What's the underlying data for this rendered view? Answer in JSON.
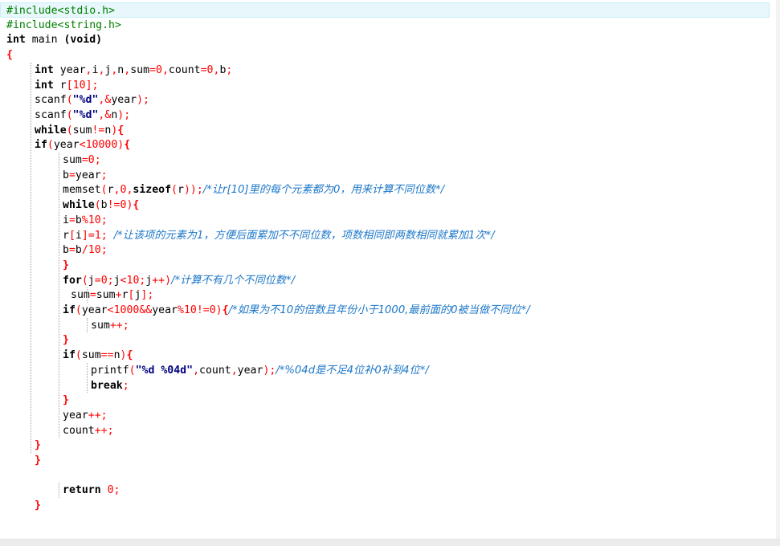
{
  "editor": {
    "language": "C",
    "lines": [
      {
        "indent": 0,
        "tokens": [
          [
            "pp",
            "#include<stdio.h>"
          ]
        ]
      },
      {
        "indent": 0,
        "tokens": [
          [
            "pp",
            "#include<string.h>"
          ]
        ]
      },
      {
        "indent": 0,
        "tokens": [
          [
            "kw",
            "int"
          ],
          [
            "id",
            " main "
          ],
          [
            "kw",
            "(void)"
          ]
        ]
      },
      {
        "indent": 0,
        "tokens": [
          [
            "brace",
            "{"
          ]
        ]
      },
      {
        "indent": 1,
        "tokens": [
          [
            "kw",
            "int"
          ],
          [
            "id",
            " year"
          ],
          [
            "op",
            ","
          ],
          [
            "id",
            "i"
          ],
          [
            "op",
            ","
          ],
          [
            "id",
            "j"
          ],
          [
            "op",
            ","
          ],
          [
            "id",
            "n"
          ],
          [
            "op",
            ","
          ],
          [
            "id",
            "sum"
          ],
          [
            "op",
            "="
          ],
          [
            "num",
            "0"
          ],
          [
            "op",
            ","
          ],
          [
            "id",
            "count"
          ],
          [
            "op",
            "="
          ],
          [
            "num",
            "0"
          ],
          [
            "op",
            ","
          ],
          [
            "id",
            "b"
          ],
          [
            "op",
            ";"
          ]
        ]
      },
      {
        "indent": 1,
        "tokens": [
          [
            "kw",
            "int"
          ],
          [
            "id",
            " r"
          ],
          [
            "op",
            "["
          ],
          [
            "num",
            "10"
          ],
          [
            "op",
            "]"
          ],
          [
            "op",
            ";"
          ]
        ]
      },
      {
        "indent": 1,
        "tokens": [
          [
            "id",
            "scanf"
          ],
          [
            "op",
            "("
          ],
          [
            "str",
            "\"%d\""
          ],
          [
            "op",
            ","
          ],
          [
            "op",
            "&"
          ],
          [
            "id",
            "year"
          ],
          [
            "op",
            ")"
          ],
          [
            "op",
            ";"
          ]
        ]
      },
      {
        "indent": 1,
        "tokens": [
          [
            "id",
            "scanf"
          ],
          [
            "op",
            "("
          ],
          [
            "str",
            "\"%d\""
          ],
          [
            "op",
            ","
          ],
          [
            "op",
            "&"
          ],
          [
            "id",
            "n"
          ],
          [
            "op",
            ")"
          ],
          [
            "op",
            ";"
          ]
        ]
      },
      {
        "indent": 1,
        "tokens": [
          [
            "kw",
            "while"
          ],
          [
            "op",
            "("
          ],
          [
            "id",
            "sum"
          ],
          [
            "op",
            "!="
          ],
          [
            "id",
            "n"
          ],
          [
            "op",
            ")"
          ],
          [
            "brace",
            "{"
          ]
        ]
      },
      {
        "indent": 1,
        "tokens": [
          [
            "kw",
            "if"
          ],
          [
            "op",
            "("
          ],
          [
            "id",
            "year"
          ],
          [
            "op",
            "<"
          ],
          [
            "num",
            "10000"
          ],
          [
            "op",
            ")"
          ],
          [
            "brace",
            "{"
          ]
        ]
      },
      {
        "indent": 2,
        "tokens": [
          [
            "id",
            "sum"
          ],
          [
            "op",
            "="
          ],
          [
            "num",
            "0"
          ],
          [
            "op",
            ";"
          ]
        ]
      },
      {
        "indent": 2,
        "tokens": [
          [
            "id",
            "b"
          ],
          [
            "op",
            "="
          ],
          [
            "id",
            "year"
          ],
          [
            "op",
            ";"
          ]
        ]
      },
      {
        "indent": 2,
        "tokens": [
          [
            "id",
            "memset"
          ],
          [
            "op",
            "("
          ],
          [
            "id",
            "r"
          ],
          [
            "op",
            ","
          ],
          [
            "num",
            "0"
          ],
          [
            "op",
            ","
          ],
          [
            "kw",
            "sizeof"
          ],
          [
            "op",
            "("
          ],
          [
            "id",
            "r"
          ],
          [
            "op",
            "))"
          ],
          [
            "op",
            ";"
          ],
          [
            "cmt",
            "/*让r[10]里的每个元素都为0，用来计算不同位数*/"
          ]
        ]
      },
      {
        "indent": 2,
        "tokens": [
          [
            "kw",
            "while"
          ],
          [
            "op",
            "("
          ],
          [
            "id",
            "b"
          ],
          [
            "op",
            "!="
          ],
          [
            "num",
            "0"
          ],
          [
            "op",
            ")"
          ],
          [
            "brace",
            "{"
          ]
        ]
      },
      {
        "indent": 2,
        "tokens": [
          [
            "id",
            "i"
          ],
          [
            "op",
            "="
          ],
          [
            "id",
            "b"
          ],
          [
            "op",
            "%"
          ],
          [
            "num",
            "10"
          ],
          [
            "op",
            ";"
          ]
        ]
      },
      {
        "indent": 2,
        "tokens": [
          [
            "id",
            "r"
          ],
          [
            "op",
            "["
          ],
          [
            "id",
            "i"
          ],
          [
            "op",
            "]="
          ],
          [
            "num",
            "1"
          ],
          [
            "op",
            ";"
          ],
          [
            "id",
            " "
          ],
          [
            "cmt",
            "/*让该项的元素为1，方便后面累加不不同位数，项数相同即两数相同就累加1次*/"
          ]
        ]
      },
      {
        "indent": 2,
        "tokens": [
          [
            "id",
            "b"
          ],
          [
            "op",
            "="
          ],
          [
            "id",
            "b"
          ],
          [
            "op",
            "/"
          ],
          [
            "num",
            "10"
          ],
          [
            "op",
            ";"
          ]
        ]
      },
      {
        "indent": 2,
        "tokens": [
          [
            "brace",
            "}"
          ]
        ]
      },
      {
        "indent": 2,
        "tokens": [
          [
            "kw",
            "for"
          ],
          [
            "op",
            "("
          ],
          [
            "id",
            "j"
          ],
          [
            "op",
            "="
          ],
          [
            "num",
            "0"
          ],
          [
            "op",
            ";"
          ],
          [
            "id",
            "j"
          ],
          [
            "op",
            "<"
          ],
          [
            "num",
            "10"
          ],
          [
            "op",
            ";"
          ],
          [
            "id",
            "j"
          ],
          [
            "op",
            "++)"
          ],
          [
            "cmt",
            "/*计算不有几个不同位数*/"
          ]
        ]
      },
      {
        "indent": 2,
        "extra": 1,
        "tokens": [
          [
            "id",
            "sum"
          ],
          [
            "op",
            "="
          ],
          [
            "id",
            "sum"
          ],
          [
            "op",
            "+"
          ],
          [
            "id",
            "r"
          ],
          [
            "op",
            "["
          ],
          [
            "id",
            "j"
          ],
          [
            "op",
            "]"
          ],
          [
            "op",
            ";"
          ]
        ]
      },
      {
        "indent": 2,
        "tokens": [
          [
            "kw",
            "if"
          ],
          [
            "op",
            "("
          ],
          [
            "id",
            "year"
          ],
          [
            "op",
            "<"
          ],
          [
            "num",
            "1000"
          ],
          [
            "op",
            "&&"
          ],
          [
            "id",
            "year"
          ],
          [
            "op",
            "%"
          ],
          [
            "num",
            "10"
          ],
          [
            "op",
            "!="
          ],
          [
            "num",
            "0"
          ],
          [
            "op",
            ")"
          ],
          [
            "brace",
            "{"
          ],
          [
            "cmt",
            "/*如果为不10的倍数且年份小于1000,最前面的0被当做不同位*/"
          ]
        ]
      },
      {
        "indent": 3,
        "tokens": [
          [
            "id",
            "sum"
          ],
          [
            "op",
            "++"
          ],
          [
            "op",
            ";"
          ]
        ]
      },
      {
        "indent": 2,
        "tokens": [
          [
            "brace",
            "}"
          ]
        ]
      },
      {
        "indent": 2,
        "tokens": [
          [
            "kw",
            "if"
          ],
          [
            "op",
            "("
          ],
          [
            "id",
            "sum"
          ],
          [
            "op",
            "=="
          ],
          [
            "id",
            "n"
          ],
          [
            "op",
            ")"
          ],
          [
            "brace",
            "{"
          ]
        ]
      },
      {
        "indent": 3,
        "tokens": [
          [
            "id",
            "printf"
          ],
          [
            "op",
            "("
          ],
          [
            "str",
            "\"%d %04d\""
          ],
          [
            "op",
            ","
          ],
          [
            "id",
            "count"
          ],
          [
            "op",
            ","
          ],
          [
            "id",
            "year"
          ],
          [
            "op",
            ")"
          ],
          [
            "op",
            ";"
          ],
          [
            "cmt",
            "/*%04d是不足4位补0补到4位*/"
          ]
        ]
      },
      {
        "indent": 3,
        "tokens": [
          [
            "kw",
            "break"
          ],
          [
            "op",
            ";"
          ]
        ]
      },
      {
        "indent": 2,
        "tokens": [
          [
            "brace",
            "}"
          ]
        ]
      },
      {
        "indent": 2,
        "tokens": [
          [
            "id",
            "year"
          ],
          [
            "op",
            "++"
          ],
          [
            "op",
            ";"
          ]
        ]
      },
      {
        "indent": 2,
        "tokens": [
          [
            "id",
            "count"
          ],
          [
            "op",
            "++"
          ],
          [
            "op",
            ";"
          ]
        ]
      },
      {
        "indent": 1,
        "tokens": [
          [
            "brace",
            "}"
          ]
        ]
      },
      {
        "indent": 1,
        "tokens": [
          [
            "brace",
            "}"
          ]
        ]
      },
      {
        "indent": 0,
        "tokens": []
      },
      {
        "indent": 2,
        "tokens": [
          [
            "kw",
            "return"
          ],
          [
            "id",
            " "
          ],
          [
            "num",
            "0"
          ],
          [
            "op",
            ";"
          ]
        ]
      },
      {
        "indent": 1,
        "tokens": [
          [
            "brace",
            "}"
          ]
        ]
      }
    ],
    "current_line": 0
  }
}
